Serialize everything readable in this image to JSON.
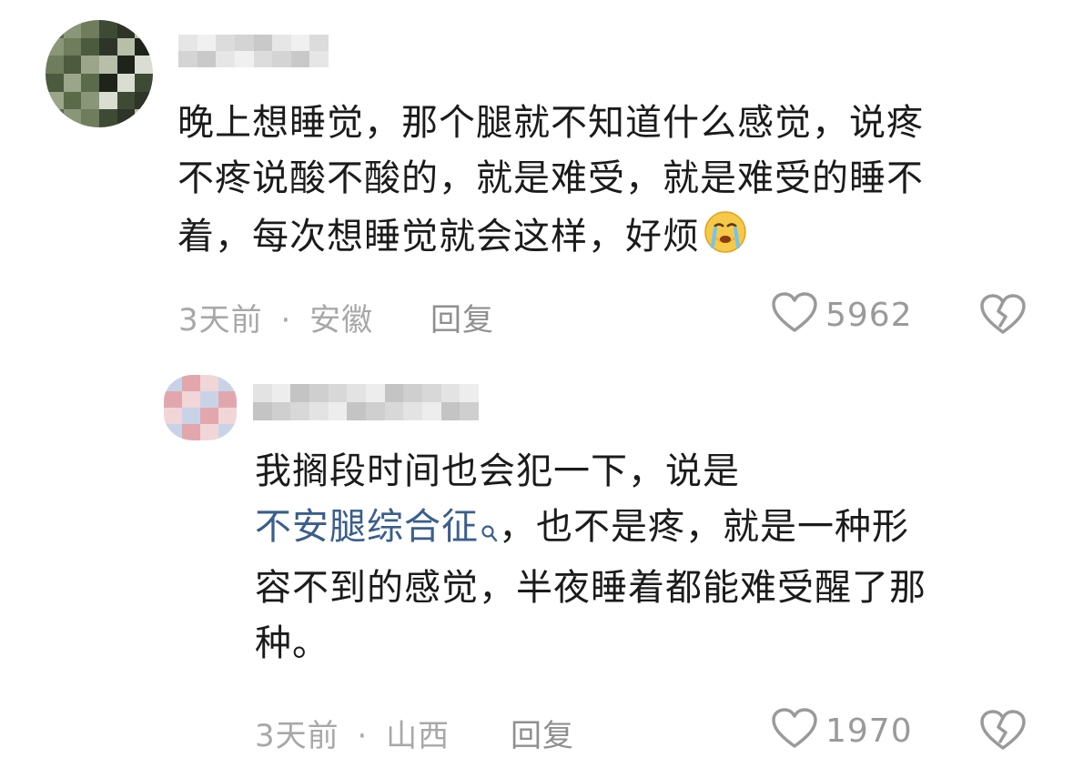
{
  "comments": [
    {
      "lines": [
        "晚上想睡觉，那个腿就不知道什么感觉，说疼",
        "不疼说酸不酸的，就是难受，就是难受的睡不",
        "着，每次想睡觉就会这样，好烦"
      ],
      "emoji_icon": "crying-face-icon",
      "time": "3天前",
      "separator": "·",
      "location": "安徽",
      "reply_label": "回复",
      "like_icon": "heart-icon",
      "likes": "5962",
      "dislike_icon": "broken-heart-icon"
    },
    {
      "line1": "我搁段时间也会犯一下，说是",
      "link_text": "不安腿综合征",
      "link_icon": "search-icon",
      "line2_rest": "，也不是疼，就是一种形",
      "line3": "容不到的感觉，半夜睡着都能难受醒了那",
      "line4": "种。",
      "time": "3天前",
      "separator": "·",
      "location": "山西",
      "reply_label": "回复",
      "like_icon": "heart-icon",
      "likes": "1970",
      "dislike_icon": "broken-heart-icon"
    }
  ],
  "colors": {
    "text": "#1b1b1b",
    "meta": "#a8a8a8",
    "link": "#3a5e8c",
    "icon": "#9a9a9a"
  }
}
